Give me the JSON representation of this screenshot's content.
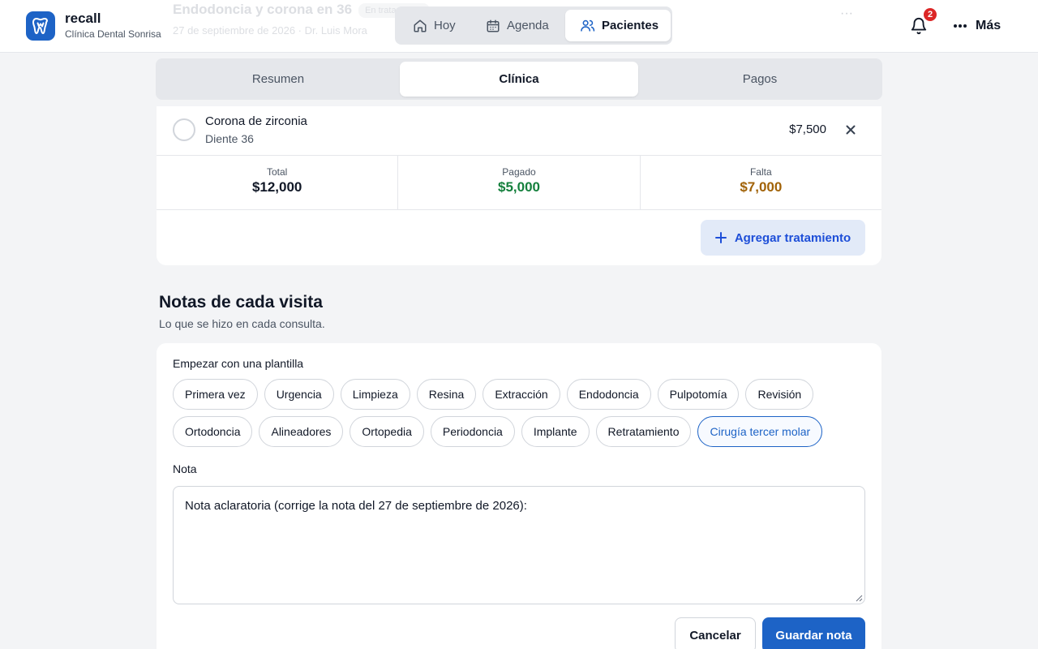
{
  "header": {
    "brand": "recall",
    "clinic": "Clínica Dental Sonrisa",
    "ghost_title": "Endodoncia y corona en 36",
    "ghost_pill": "En tratamiento",
    "ghost_subtitle": "27 de septiembre de 2026 · Dr. Luis Mora",
    "nav": [
      {
        "label": "Hoy",
        "icon": "home-icon"
      },
      {
        "label": "Agenda",
        "icon": "calendar-icon"
      },
      {
        "label": "Pacientes",
        "icon": "users-icon",
        "active": true
      }
    ],
    "notifications_count": "2",
    "more_label": "Más"
  },
  "tabs": [
    {
      "label": "Resumen"
    },
    {
      "label": "Clínica",
      "active": true
    },
    {
      "label": "Pagos"
    }
  ],
  "treatment": {
    "name": "Corona de zirconia",
    "tooth": "Diente 36",
    "price": "$7,500"
  },
  "totals": {
    "total_label": "Total",
    "total_value": "$12,000",
    "paid_label": "Pagado",
    "paid_value": "$5,000",
    "due_label": "Falta",
    "due_value": "$7,000",
    "paid_color": "#15803d",
    "due_color": "#a16207"
  },
  "add_treatment_label": "Agregar tratamiento",
  "notes": {
    "title": "Notas de cada visita",
    "subtitle": "Lo que se hizo en cada consulta.",
    "template_label": "Empezar con una plantilla",
    "templates": [
      "Primera vez",
      "Urgencia",
      "Limpieza",
      "Resina",
      "Extracción",
      "Endodoncia",
      "Pulpotomía",
      "Revisión",
      "Ortodoncia",
      "Alineadores",
      "Ortopedia",
      "Periodoncia",
      "Implante",
      "Retratamiento",
      "Cirugía tercer molar"
    ],
    "selected_template": "Cirugía tercer molar",
    "note_label": "Nota",
    "note_value": "Nota aclaratoria (corrige la nota del 27 de septiembre de 2026):",
    "cancel_label": "Cancelar",
    "save_label": "Guardar nota"
  },
  "colors": {
    "accent": "#1d63c6",
    "badge": "#dc2626"
  }
}
